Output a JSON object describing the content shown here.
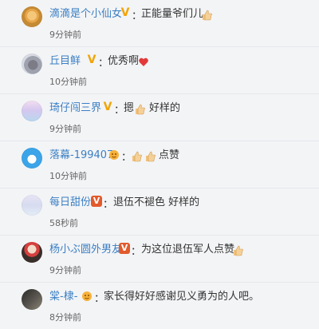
{
  "comments": [
    {
      "name": "滴滴是个小仙女",
      "colon": "：",
      "text": "正能量爷们儿",
      "time": "9分钟前"
    },
    {
      "name": "丘目鲜",
      "colon": "：",
      "text": "优秀啊",
      "time": "10分钟前"
    },
    {
      "name": "琦仔闯三界",
      "colon": "：",
      "text": "摁",
      "text2": "好样的",
      "time": "9分钟前"
    },
    {
      "name": "落幕-199407",
      "colon": "：",
      "text": "点赞",
      "time": "10分钟前"
    },
    {
      "name": "每日甜份",
      "colon": "：",
      "text": "退伍不褪色 好样的",
      "time": "58秒前"
    },
    {
      "name": "杨小ぶ圆外男友",
      "colon": "：",
      "text": "为这位退伍军人点赞",
      "time": "9分钟前"
    },
    {
      "name": "棠-棣-",
      "colon": "：",
      "text": "家长得好好感谢见义勇为的人吧。",
      "time": "8分钟前"
    }
  ]
}
